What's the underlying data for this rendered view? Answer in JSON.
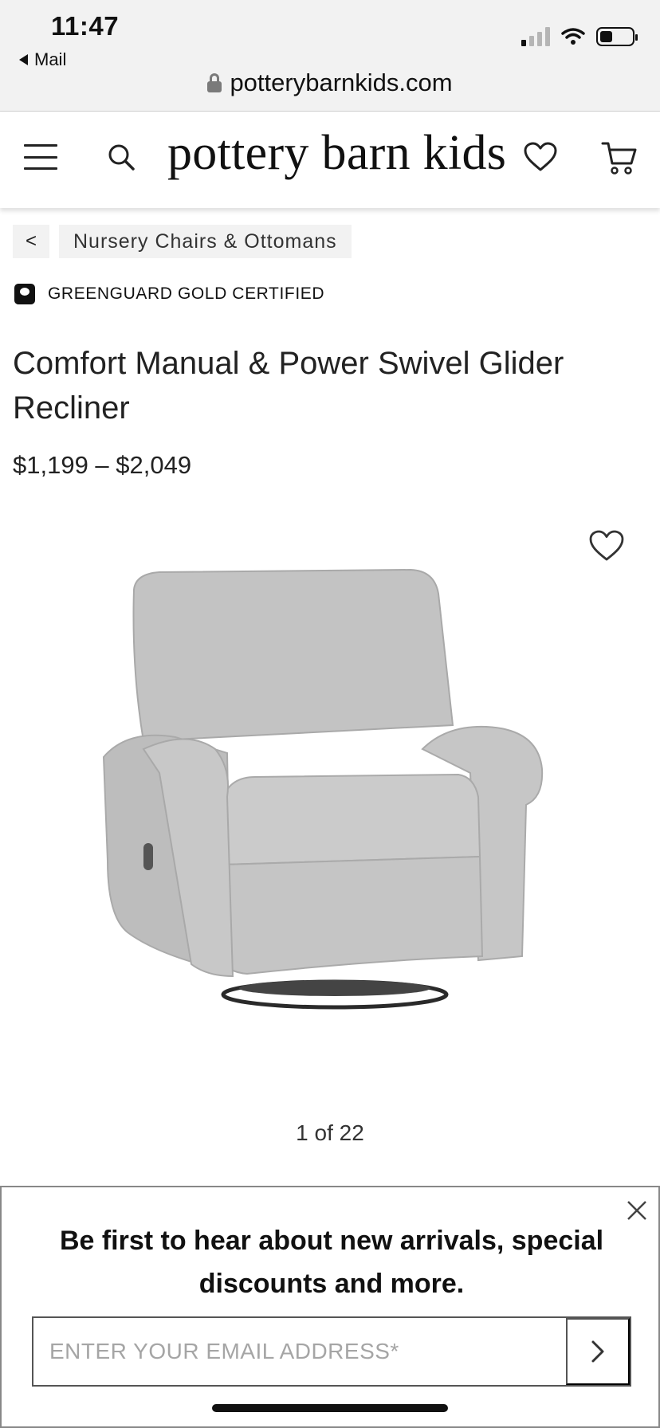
{
  "status_bar": {
    "time": "11:47",
    "back_app": "Mail"
  },
  "browser": {
    "url": "potterybarnkids.com"
  },
  "header": {
    "logo": "pottery barn kids",
    "icons": [
      "menu-icon",
      "search-icon",
      "heart-icon",
      "cart-icon"
    ]
  },
  "breadcrumb": {
    "back_label": "<",
    "category": "Nursery Chairs & Ottomans"
  },
  "certification": {
    "label": "GREENGUARD GOLD CERTIFIED"
  },
  "product": {
    "title": "Comfort Manual & Power Swivel Glider Recliner",
    "price": "$1,199 – $2,049",
    "image_pager": "1 of 22",
    "image_alt_color": "#c9c9c9"
  },
  "newsletter": {
    "headline": "Be first to hear about new arrivals, special discounts and more.",
    "email_placeholder": "ENTER YOUR EMAIL ADDRESS*"
  }
}
